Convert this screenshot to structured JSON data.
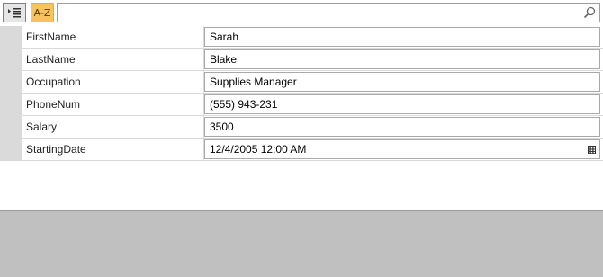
{
  "toolbar": {
    "categorize_icon": "categorized-list-icon",
    "alphabetical_label": "A-Z",
    "search_placeholder": "",
    "search_icon": "search-icon"
  },
  "properties": [
    {
      "name": "FirstName",
      "value": "Sarah"
    },
    {
      "name": "LastName",
      "value": "Blake"
    },
    {
      "name": "Occupation",
      "value": "Supplies Manager"
    },
    {
      "name": "PhoneNum",
      "value": "(555) 943-231"
    },
    {
      "name": "Salary",
      "value": "3500"
    },
    {
      "name": "StartingDate",
      "value": "12/4/2005 12:00 AM",
      "icon": "calendar-icon"
    }
  ],
  "colors": {
    "accent": "#f7c35e",
    "grid_lines": "#dadada",
    "description_panel": "#c0c0c0"
  }
}
